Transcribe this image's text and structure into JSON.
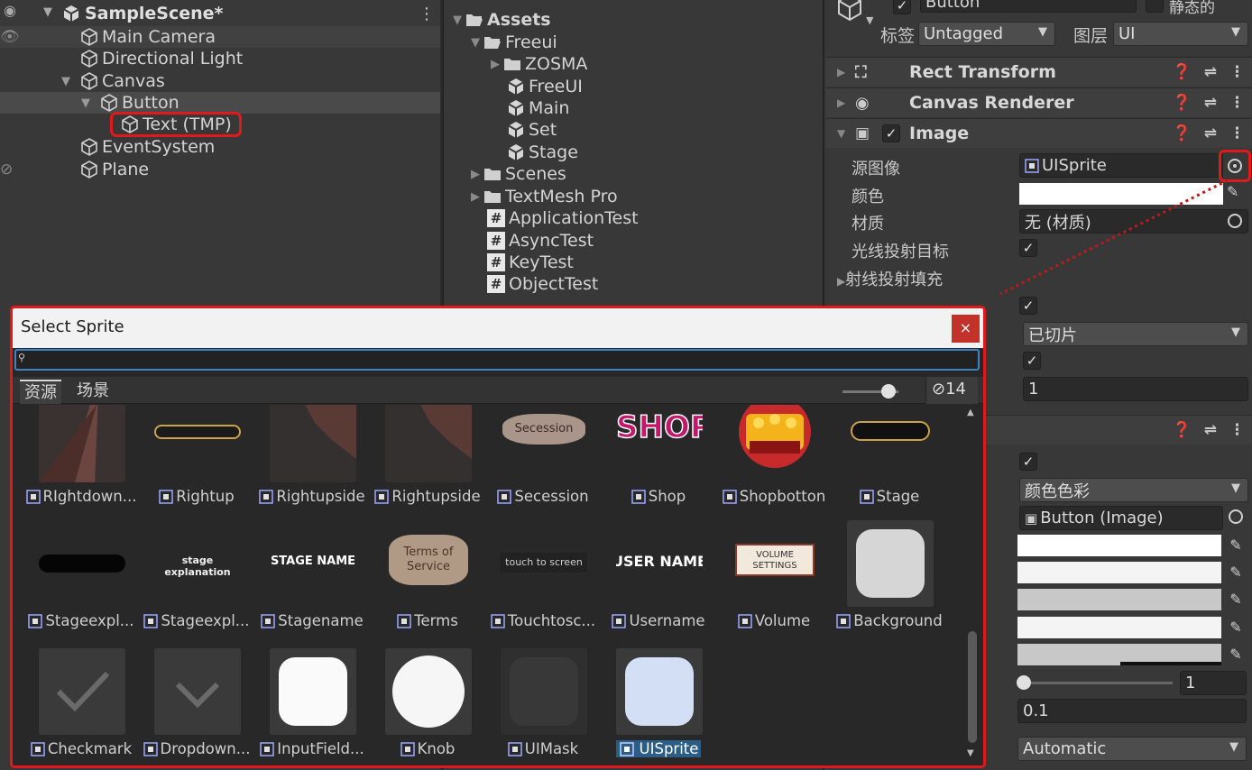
{
  "hierarchy": {
    "scene": "SampleScene*",
    "items": [
      "Main Camera",
      "Directional Light",
      "Canvas",
      "Button",
      "Text (TMP)",
      "EventSystem",
      "Plane"
    ]
  },
  "project": {
    "items": [
      "Assets",
      "Freeui",
      "ZOSMA",
      "FreeUI",
      "Main",
      "Set",
      "Stage",
      "Scenes",
      "TextMesh Pro",
      "ApplicationTest",
      "AsyncTest",
      "KeyTest",
      "ObjectTest"
    ]
  },
  "inspector": {
    "object_name": "Button",
    "static_label": "静态的",
    "tag_label": "标签",
    "tag_value": "Untagged",
    "layer_label": "图层",
    "layer_value": "UI",
    "components": [
      "Rect Transform",
      "Canvas Renderer",
      "Image"
    ],
    "image": {
      "source_label": "源图像",
      "source_value": "UISprite",
      "color_label": "颜色",
      "material_label": "材质",
      "material_value": "无 (材质)",
      "raycast_label": "光线投射目标",
      "raycast_padding_label": "射线投射填充",
      "image_type_value": "已切片",
      "pixels_value": "1"
    },
    "button": {
      "transition_value": "颜色色彩",
      "target_graphic_value": "Button (Image)",
      "color_multiplier_value": "1",
      "fade_duration_value": "0.1",
      "navigation_value": "Automatic"
    }
  },
  "dialog": {
    "title": "Select Sprite",
    "close": "×",
    "tabs": [
      "资源",
      "场景"
    ],
    "count": "14",
    "rows": [
      [
        "RIghtdown...",
        "Rightup",
        "Rightupside",
        "Rightupside",
        "Secession",
        "Shop",
        "Shopbotton",
        "Stage"
      ],
      [
        "Stageexpl...",
        "Stageexpl...",
        "Stagename",
        "Terms",
        "Touchtosc...",
        "Username",
        "Volume",
        "Background"
      ],
      [
        "Checkmark",
        "Dropdown...",
        "InputField...",
        "Knob",
        "UIMask",
        "UISprite"
      ]
    ],
    "thumb_text": {
      "secession": "Secession",
      "shop": "SHOP",
      "stage_explanation": "stage explanation",
      "stage_name": "STAGE NAME",
      "terms": "Terms of Service",
      "touch": "touch to screen",
      "username": "USER NAME",
      "volume": "VOLUME SETTINGS"
    }
  },
  "colors": {
    "highlight": "#e0191a",
    "selection": "#2c5d87",
    "uisprite_thumb": "#d3dff5"
  }
}
